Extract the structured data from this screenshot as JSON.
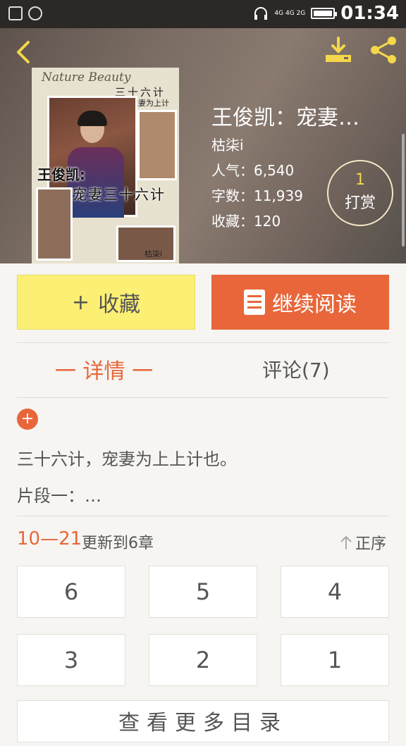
{
  "status_bar": {
    "time": "01:34",
    "network": "4G 4G 2G"
  },
  "cover": {
    "en_title": "Nature Beauty",
    "cn_title1": "三十六计",
    "cn_title2": "宠妻为上计",
    "big1": "王俊凯:",
    "big2": "宠妻三十六计",
    "sign": "枯柒i"
  },
  "book": {
    "title": "王俊凯：宠妻…",
    "author": "枯柒i",
    "popularity": "人气：6,540",
    "word_count": "字数：11,939",
    "favorites": "收藏：120"
  },
  "tip": {
    "count": "1",
    "label": "打赏"
  },
  "buttons": {
    "favorite": "收藏",
    "favorite_plus": "+",
    "continue_reading": "继续阅读"
  },
  "tabs": {
    "detail": "一 详情 一",
    "comments": "评论(7)"
  },
  "detail": {
    "expand": "+",
    "line1": "三十六计，宠妻为上上计也。",
    "line2": "片段一：…"
  },
  "chapters_header": {
    "date": "10—21",
    "update": "更新到6章",
    "sort": "正序"
  },
  "chapters": [
    "6",
    "5",
    "4",
    "3",
    "2",
    "1"
  ],
  "more_label": "查看更多目录",
  "colors": {
    "accent": "#e8663a",
    "favorite_bg": "#fbef74",
    "icon_yellow": "#f4d74a"
  }
}
